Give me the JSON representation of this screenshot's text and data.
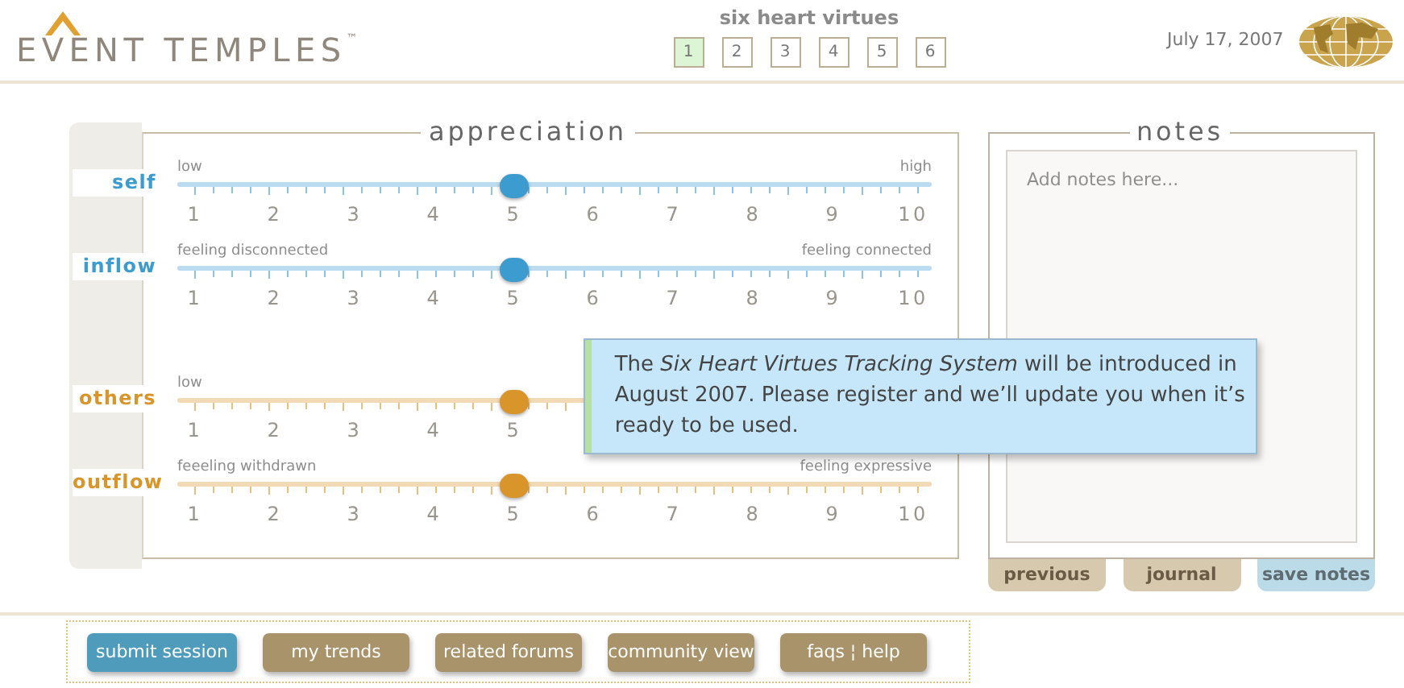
{
  "logo": {
    "name": "EVENT TEMPLES",
    "trademark": "™"
  },
  "header": {
    "title": "six heart virtues",
    "pages": [
      {
        "label": "1",
        "selected": true
      },
      {
        "label": "2",
        "selected": false
      },
      {
        "label": "3",
        "selected": false
      },
      {
        "label": "4",
        "selected": false
      },
      {
        "label": "5",
        "selected": false
      },
      {
        "label": "6",
        "selected": false
      }
    ],
    "date": "July 17, 2007"
  },
  "appreciation": {
    "title": "appreciation",
    "slider_groups": [
      {
        "sliders": [
          {
            "label": "self",
            "color": "#3c9ccf",
            "low": "low",
            "high": "high",
            "level": 0.447,
            "numbers": [
              "1",
              "2",
              "3",
              "4",
              "5",
              "6",
              "7",
              "8",
              "9",
              "10"
            ]
          },
          {
            "label": "inflow",
            "color": "#3c9ccf",
            "low": "feeling disconnected",
            "high": "feeling connected",
            "level": 0.447,
            "numbers": [
              "1",
              "2",
              "3",
              "4",
              "5",
              "6",
              "7",
              "8",
              "9",
              "10"
            ]
          }
        ]
      },
      {
        "sliders": [
          {
            "label": "others",
            "color": "#d9952a",
            "low": "low",
            "level": 0.447,
            "numbers": [
              "1",
              "2",
              "3",
              "4",
              "5"
            ]
          },
          {
            "label": "outflow",
            "color": "#d9952a",
            "low": "feeeling withdrawn",
            "high": "feeling expressive",
            "level": 0.447,
            "numbers": [
              "1",
              "2",
              "3",
              "4",
              "5",
              "6",
              "7",
              "8",
              "9",
              "10"
            ]
          }
        ]
      }
    ]
  },
  "notes": {
    "title": "notes",
    "placeholder": "Add notes here...",
    "buttons": [
      {
        "label": "previous",
        "kind": "plain"
      },
      {
        "label": "journal",
        "kind": "plain"
      },
      {
        "label": "save notes",
        "kind": "primary"
      }
    ]
  },
  "nav_buttons": [
    {
      "label": "submit session",
      "kind": "primary"
    },
    {
      "label": "my trends",
      "kind": "plain"
    },
    {
      "label": "related forums",
      "kind": "plain"
    },
    {
      "label": "community view",
      "kind": "plain"
    },
    {
      "label": "faqs ¦ help",
      "kind": "plain"
    }
  ],
  "notice": {
    "text": "The *Six Heart Virtues Tracking System* will be introduced in August 2007. Please register and we’ll update you when it’s ready to be used."
  }
}
